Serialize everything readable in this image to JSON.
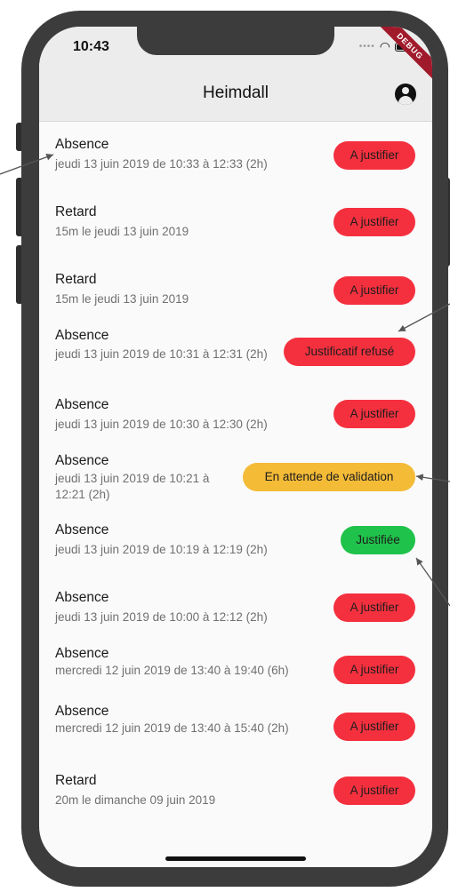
{
  "status_bar": {
    "time": "10:43",
    "debug_label": "DEBUG"
  },
  "app_bar": {
    "title": "Heimdall",
    "account_icon": "account-circle-icon"
  },
  "items": [
    {
      "title": "Absence",
      "subtitle": "jeudi 13 juin 2019 de 10:33 à 12:33 (2h)",
      "badge": "A justifier",
      "status": "red"
    },
    {
      "title": "Retard",
      "subtitle": "15m le jeudi 13 juin 2019",
      "badge": "A justifier",
      "status": "red"
    },
    {
      "title": "Retard",
      "subtitle": "15m le jeudi 13 juin 2019",
      "badge": "A justifier",
      "status": "red"
    },
    {
      "title": "Absence",
      "subtitle": "jeudi 13 juin 2019 de 10:31 à 12:31 (2h)",
      "badge": "Justificatif refusé",
      "status": "red"
    },
    {
      "title": "Absence",
      "subtitle": "jeudi 13 juin 2019 de 10:30 à 12:30 (2h)",
      "badge": "A justifier",
      "status": "red"
    },
    {
      "title": "Absence",
      "subtitle": "jeudi 13 juin 2019 de 10:21 à 12:21 (2h)",
      "badge": "En attende de validation",
      "status": "orange"
    },
    {
      "title": "Absence",
      "subtitle": "jeudi 13 juin 2019 de 10:19 à 12:19 (2h)",
      "badge": "Justifiée",
      "status": "green"
    },
    {
      "title": "Absence",
      "subtitle": "jeudi 13 juin 2019 de 10:00 à 12:12 (2h)",
      "badge": "A justifier",
      "status": "red"
    },
    {
      "title": "Absence",
      "subtitle": "mercredi 12 juin 2019 de 13:40 à 19:40 (6h)",
      "badge": "A justifier",
      "status": "red"
    },
    {
      "title": "Absence",
      "subtitle": "mercredi 12 juin 2019 de 13:40 à 15:40 (2h)",
      "badge": "A justifier",
      "status": "red"
    },
    {
      "title": "Retard",
      "subtitle": "20m le dimanche 09 juin 2019",
      "badge": "A justifier",
      "status": "red"
    }
  ],
  "colors": {
    "red": "#f5303e",
    "orange": "#f4bb37",
    "green": "#1fc24a",
    "app_bar": "#ececec",
    "phone_frame": "#3c3c3c"
  }
}
